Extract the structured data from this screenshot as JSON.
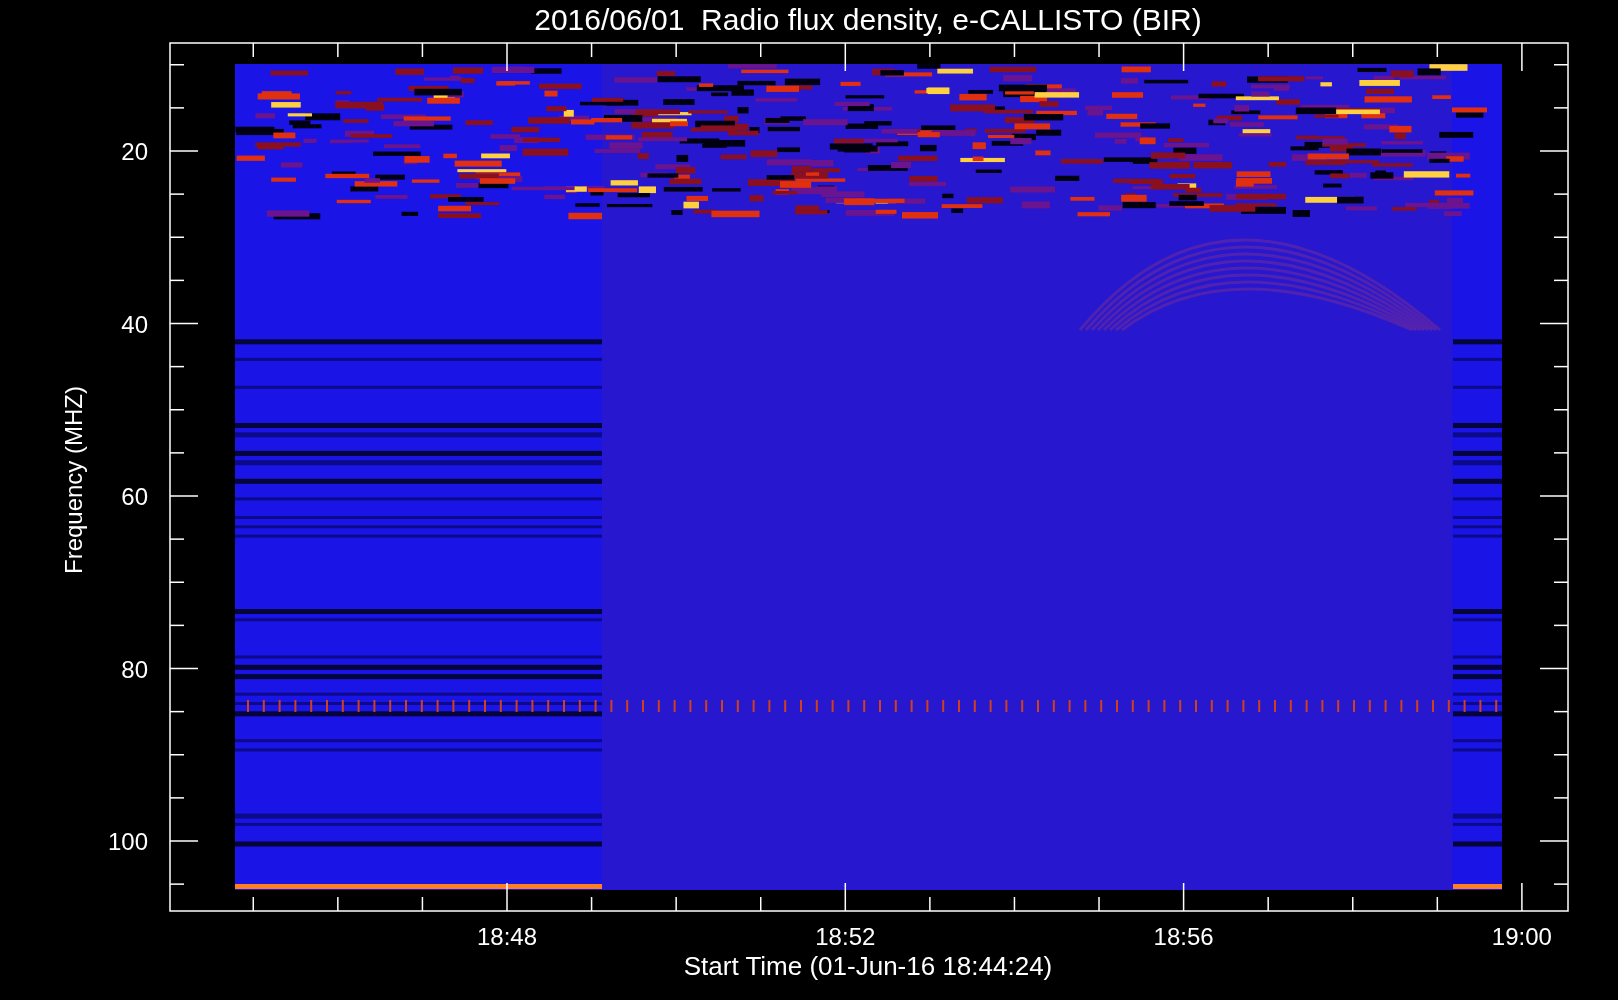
{
  "title": "2016/06/01  Radio flux density, e-CALLISTO (BIR)",
  "y_axis": {
    "label": "Frequency (MHZ)",
    "ticks": [
      "20",
      "40",
      "60",
      "80",
      "100"
    ]
  },
  "x_axis": {
    "label": "Start Time (01-Jun-16 18:44:24)",
    "ticks": [
      "18:48",
      "18:52",
      "18:56",
      "19:00"
    ]
  }
}
